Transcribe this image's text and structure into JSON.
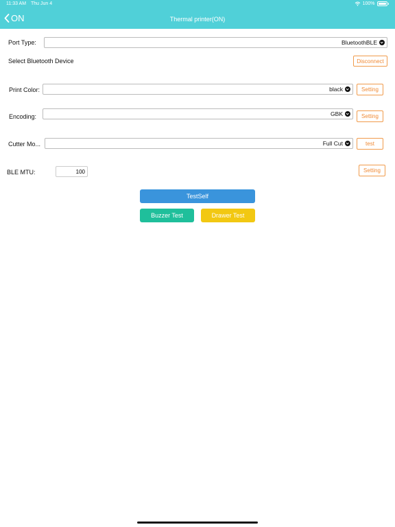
{
  "status_bar": {
    "time": "11:33 AM",
    "date": "Thu Jun 4",
    "battery": "100%"
  },
  "nav": {
    "back_label": "ON",
    "title": "Thermal  printer(ON)"
  },
  "port_type": {
    "label": "Port Type:",
    "value": "BluetoothBLE"
  },
  "bluetooth": {
    "label": "Select Bluetooth Device",
    "disconnect_label": "Disconnect"
  },
  "print_color": {
    "label": "Print Color:",
    "value": "black",
    "button_label": "Setting"
  },
  "encoding": {
    "label": "Encoding:",
    "value": "GBK",
    "button_label": "Setting"
  },
  "cutter_mode": {
    "label": "Cutter Mo...",
    "value": "Full Cut",
    "button_label": "test"
  },
  "ble_mtu": {
    "label": "BLE MTU:",
    "value": "100",
    "button_label": "Setting"
  },
  "actions": {
    "test_self": "TestSelf",
    "buzzer_test": "Buzzer Test",
    "drawer_test": "Drawer Test"
  },
  "colors": {
    "header": "#50d0d8",
    "accent_orange": "#f08a34",
    "test_self": "#3a94dc",
    "buzzer": "#1fbf9b",
    "drawer": "#f2c812"
  },
  "icons": {
    "back": "chevron-left-icon",
    "wifi": "wifi-icon",
    "battery": "battery-icon",
    "dropdown": "chevron-down-circle-icon"
  }
}
